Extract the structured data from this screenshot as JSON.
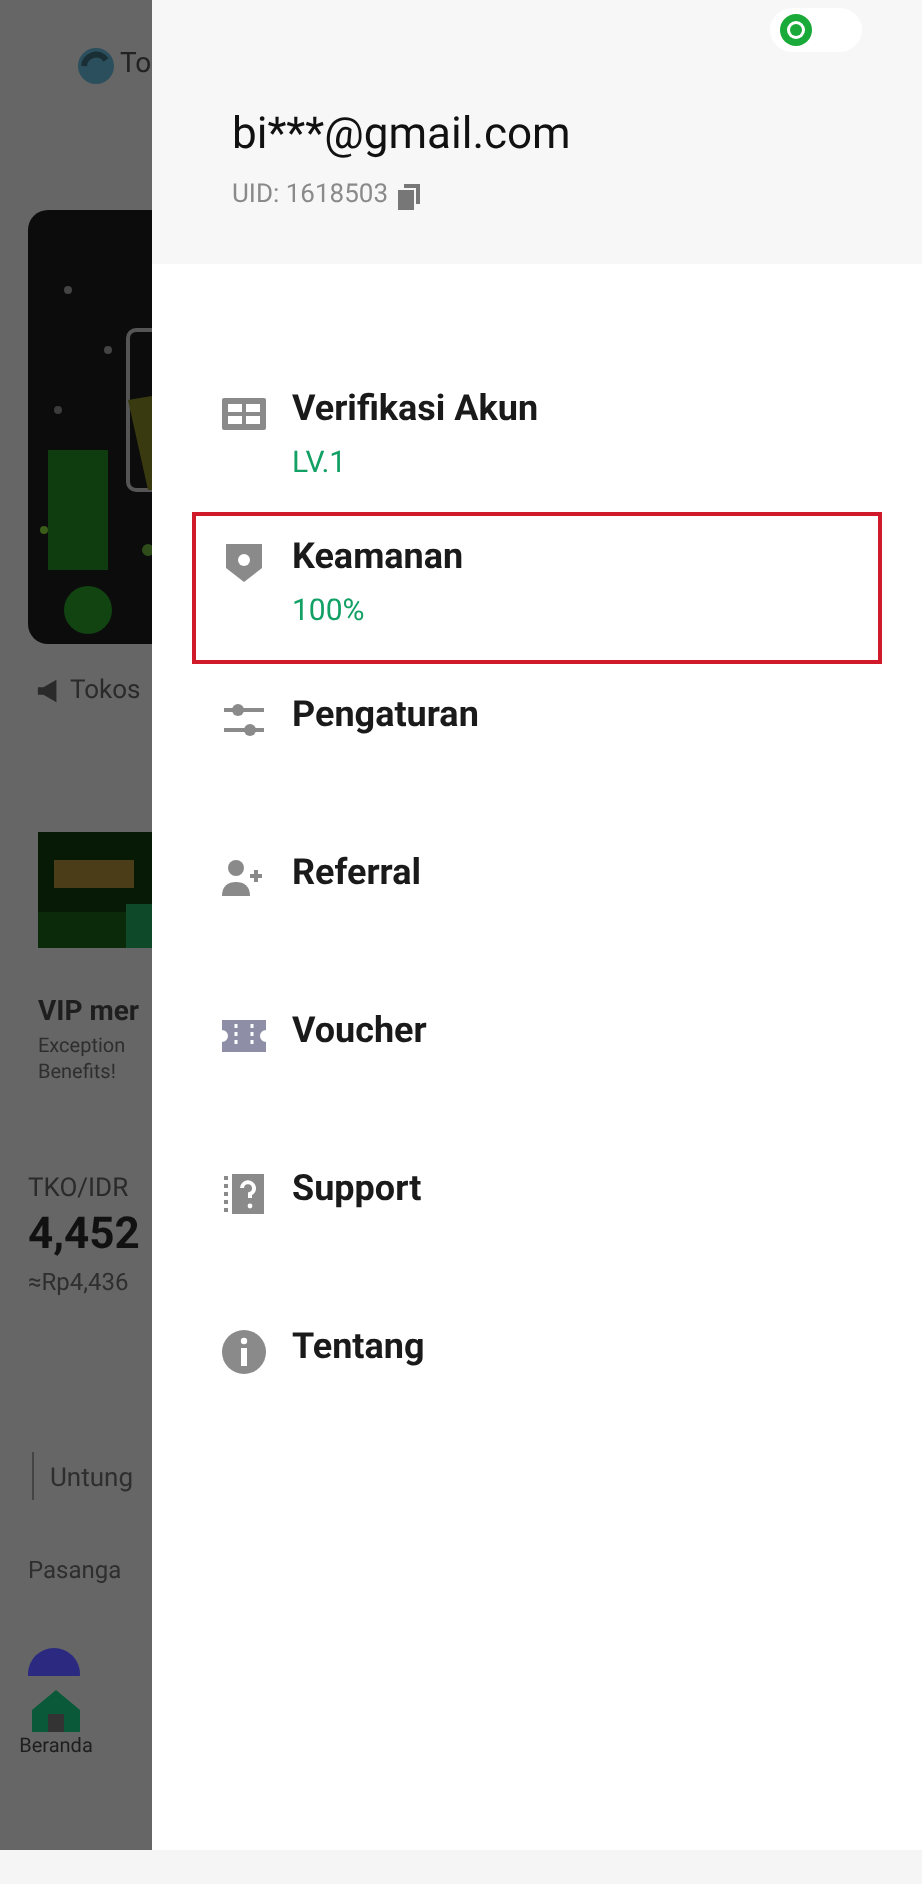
{
  "background": {
    "logo_text": "To",
    "announcement": "Tokos",
    "promo_title": "VIP mer",
    "promo_lines": [
      "Exception",
      "Benefits!"
    ],
    "pair": "TKO/IDR",
    "price": "4,452",
    "fiat_price": "≈Rp4,436",
    "tab": "Untung",
    "section": "Pasanga",
    "nav_label": "Beranda"
  },
  "drawer": {
    "theme_toggle": {
      "on": false
    },
    "email": "bi***@gmail.com",
    "uid": "UID: 1618503",
    "items": [
      {
        "kind": "id-card",
        "label": "Verifikasi Akun",
        "sub": "LV.1",
        "selected": false
      },
      {
        "kind": "shield",
        "label": "Keamanan",
        "sub": "100%",
        "selected": true
      },
      {
        "kind": "sliders",
        "label": "Pengaturan",
        "selected": false
      },
      {
        "kind": "user-plus",
        "label": "Referral",
        "selected": false
      },
      {
        "kind": "ticket",
        "label": "Voucher",
        "selected": false
      },
      {
        "kind": "help",
        "label": "Support",
        "selected": false
      },
      {
        "kind": "info",
        "label": "Tentang",
        "selected": false
      }
    ]
  }
}
